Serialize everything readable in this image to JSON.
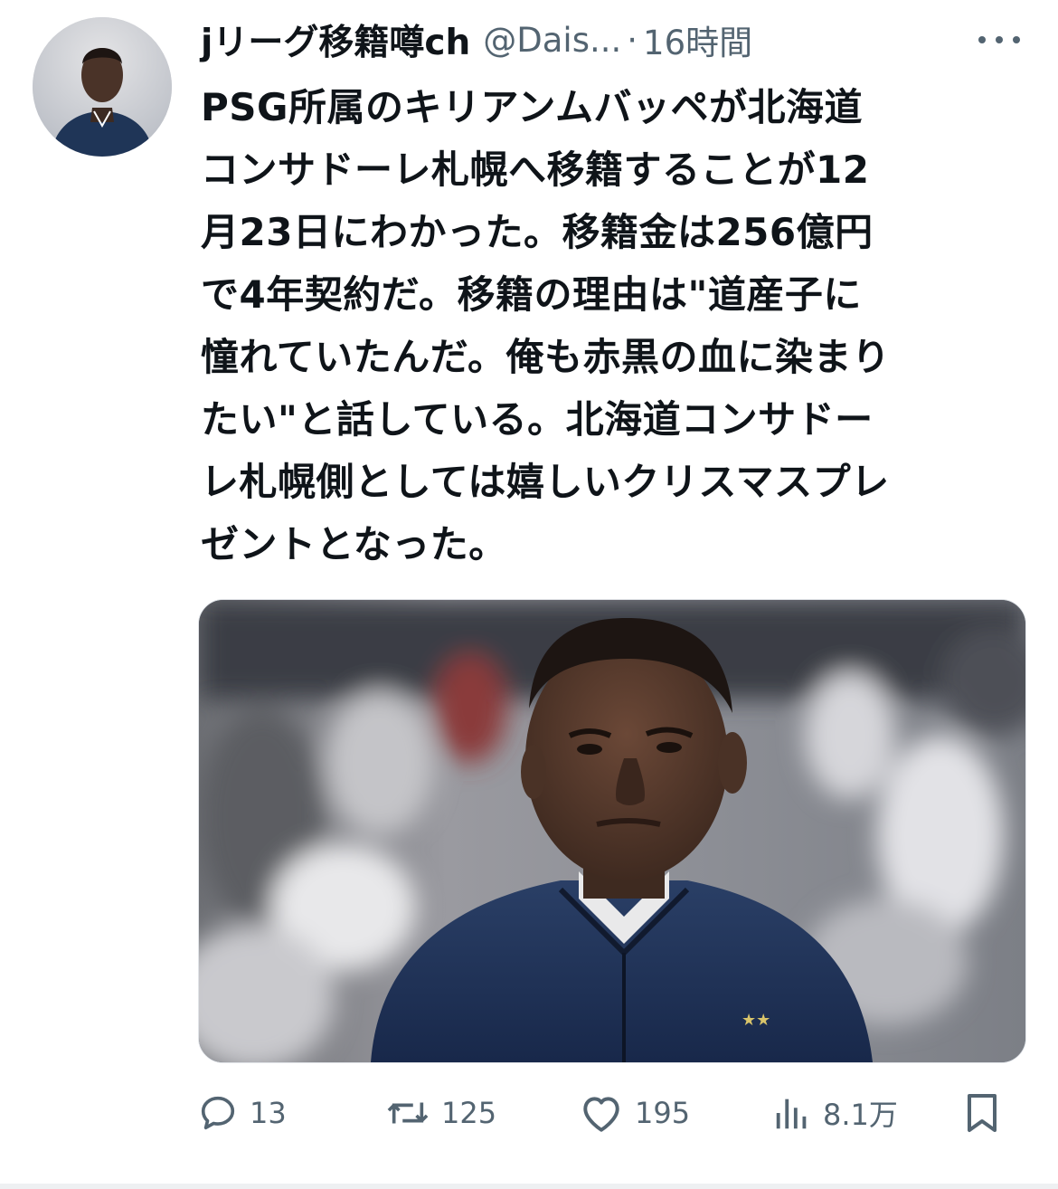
{
  "author": {
    "display_name": "jリーグ移籍噂ch",
    "handle": "@Dais...",
    "separator": "·",
    "time": "16時間"
  },
  "tweet": {
    "text": "PSG所属のキリアンムバッペが北海道\nコンサドーレ札幌へ移籍することが12\n月23日にわかった。移籍金は256億円\nで4年契約だ。移籍の理由は\"道産子に\n憧れていたんだ。俺も赤黒の血に染まり\nたい\"と話している。北海道コンサドー\nレ札幌側としては嬉しいクリスマスプレ\nゼントとなった。"
  },
  "actions": {
    "reply_count": "13",
    "retweet_count": "125",
    "like_count": "195",
    "views_count": "8.1万"
  },
  "icons": {
    "reply": "reply-icon",
    "retweet": "retweet-icon",
    "like": "heart-icon",
    "views": "views-chart-icon",
    "bookmark": "bookmark-icon",
    "more": "more-dots-icon"
  },
  "colors": {
    "text": "#0f1419",
    "secondary": "#536471",
    "background": "#ffffff"
  }
}
